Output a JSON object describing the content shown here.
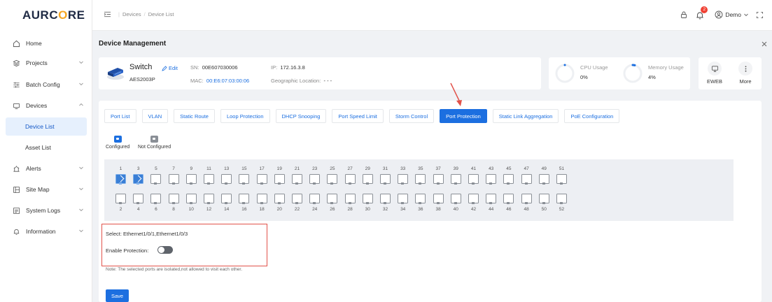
{
  "brand": {
    "logo_pre": "AURC",
    "logo_o": "O",
    "logo_post": "RE"
  },
  "sidebar": {
    "items": [
      {
        "label": "Home"
      },
      {
        "label": "Projects"
      },
      {
        "label": "Batch Config"
      },
      {
        "label": "Devices"
      },
      {
        "label": "Alerts"
      },
      {
        "label": "Site Map"
      },
      {
        "label": "System Logs"
      },
      {
        "label": "Information"
      }
    ],
    "sub_items": [
      {
        "label": "Device List",
        "active": true
      },
      {
        "label": "Asset List",
        "active": false
      }
    ]
  },
  "topbar": {
    "breadcrumb": [
      "Devices",
      "Device List"
    ],
    "notification_count": "2",
    "user": "Demo"
  },
  "page": {
    "title": "Device Management"
  },
  "device": {
    "name": "Switch",
    "edit_label": "Edit",
    "model": "AES2003P",
    "sn_label": "SN:",
    "sn": "00E607030006",
    "mac_label": "MAC:",
    "mac": "00:E6:07:03:00:06",
    "ip_label": "IP:",
    "ip": "172.16.3.8",
    "location_label": "Geographic Location:",
    "location": "- - -"
  },
  "usage": {
    "cpu_label": "CPU Usage",
    "cpu_value": "0%",
    "cpu_fraction": 0,
    "mem_label": "Memory Usage",
    "mem_value": "4%",
    "mem_fraction": 0.04
  },
  "actions": {
    "eweb": "EWEB",
    "more": "More"
  },
  "tabs": [
    "Port List",
    "VLAN",
    "Static Route",
    "Loop Protection",
    "DHCP Snooping",
    "Port Speed Limit",
    "Storm Control",
    "Port Protection",
    "Static Link Aggregation",
    "PoE Configuration"
  ],
  "active_tab": "Port Protection",
  "legend": {
    "configured": "Configured",
    "not_configured": "Not Configured"
  },
  "ports": {
    "top": [
      "1",
      "3",
      "5",
      "7",
      "9",
      "11",
      "13",
      "15",
      "17",
      "19",
      "21",
      "23",
      "25",
      "27",
      "29",
      "31",
      "33",
      "35",
      "37",
      "39",
      "41",
      "43",
      "45",
      "47",
      "49",
      "51"
    ],
    "bottom": [
      "2",
      "4",
      "6",
      "8",
      "10",
      "12",
      "14",
      "16",
      "18",
      "20",
      "22",
      "24",
      "26",
      "28",
      "30",
      "32",
      "34",
      "36",
      "38",
      "40",
      "42",
      "44",
      "46",
      "48",
      "50",
      "52"
    ],
    "selected": [
      "1",
      "3"
    ]
  },
  "form": {
    "select_text": "Select: Ethernet1/0/1,Ethernet1/0/3",
    "protection_label": "Enable Protection:",
    "protection_enabled": false,
    "note": "Note: The selected ports are isolated,not allowed to visit each other.",
    "save": "Save"
  }
}
